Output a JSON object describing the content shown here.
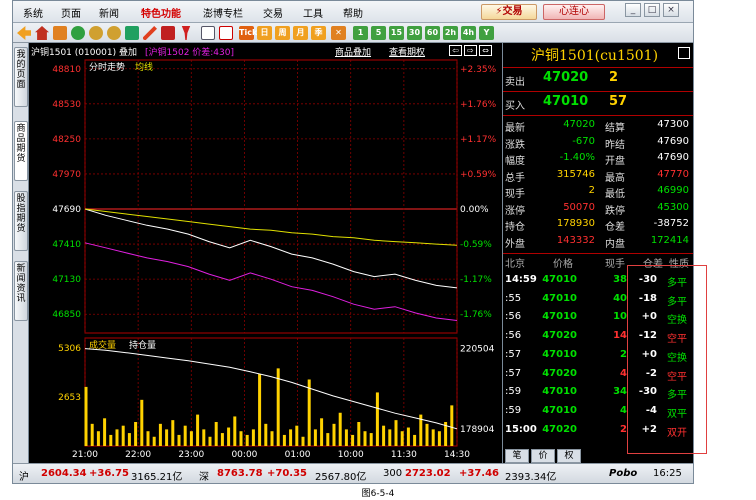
{
  "menu": {
    "items": [
      "系统",
      "页面",
      "新闻",
      "特色功能",
      "澎博专栏",
      "交易",
      "工具",
      "帮助"
    ],
    "active_index": 3,
    "trade_button": "⚡交易",
    "xinlian_button": "心连心",
    "window_buttons": [
      "_",
      "□",
      "×"
    ]
  },
  "toolbar": {
    "periods": [
      "1",
      "5",
      "15",
      "30",
      "60",
      "2h",
      "4h",
      "Y"
    ],
    "icons": [
      "back-icon",
      "home-icon",
      "book-icon",
      "refresh-icon",
      "zoom-in-icon",
      "zoom-out-icon",
      "flag-icon",
      "pen-icon",
      "delete-icon",
      "pin-icon",
      "table-icon",
      "trend-chart-icon",
      "tick-icon",
      "day-icon",
      "week-icon",
      "month-icon",
      "season-icon",
      "cross-icon"
    ],
    "tick_label": "Tick",
    "day_label": "日",
    "week_label": "周",
    "month_label": "月",
    "season_label": "季"
  },
  "side_tabs": [
    "我的页面",
    "商品期货",
    "股指期货",
    "新闻资讯"
  ],
  "chart_header": {
    "title": "沪铜1501 (010001) 叠加",
    "overlay": "[沪铜1502 价差:430]",
    "link_overlay": "商品叠加",
    "link_period": "查看期权"
  },
  "chart_data": [
    {
      "type": "line",
      "title": "分时走势",
      "legend": [
        "分时走势",
        "均线"
      ],
      "x_ticks": [
        "21:00",
        "22:00",
        "23:00",
        "00:00",
        "01:00",
        "10:00",
        "11:30",
        "14:30"
      ],
      "ylim": [
        46700,
        48880
      ],
      "y_ticks_left": [
        "48810",
        "48530",
        "48250",
        "47970",
        "47690",
        "47410",
        "47130",
        "46850"
      ],
      "y_ticks_right": [
        "+2.35%",
        "+1.76%",
        "+1.17%",
        "+0.59%",
        "0.00%",
        "-0.59%",
        "-1.17%",
        "-1.76%"
      ],
      "series": [
        {
          "name": "分时走势",
          "color": "#ffffff",
          "values": [
            47690,
            47640,
            47600,
            47560,
            47530,
            47490,
            47430,
            47380,
            47440,
            47390,
            47330,
            47300,
            47250,
            47190,
            47150,
            47170,
            47120,
            47080,
            47060
          ]
        },
        {
          "name": "均线",
          "color": "#e0e000",
          "values": [
            47690,
            47670,
            47650,
            47630,
            47610,
            47590,
            47570,
            47550,
            47530,
            47520,
            47500,
            47490,
            47470,
            47460,
            47440,
            47430,
            47420,
            47410,
            47400
          ]
        },
        {
          "color": "#e020e0",
          "values": [
            47420,
            47380,
            47340,
            47300,
            47270,
            47230,
            47170,
            47120,
            47180,
            47130,
            47070,
            47040,
            46990,
            46930,
            46890,
            46910,
            46860,
            46820,
            46800
          ]
        }
      ]
    },
    {
      "type": "bar",
      "legend": [
        "成交量",
        "持仓量"
      ],
      "y_ticks_left": [
        "5306",
        "2653"
      ],
      "y_ticks_right": [
        "220504",
        "178904"
      ],
      "open_interest": [
        220504,
        219600,
        218400,
        217000,
        215600,
        214200,
        212500,
        210800,
        208500,
        206000,
        203000,
        199500,
        196000,
        193000,
        190000,
        187000,
        184500,
        182000,
        178904
      ],
      "volume": [
        3200,
        1200,
        800,
        1500,
        600,
        900,
        1100,
        700,
        1300,
        2500,
        800,
        500,
        1200,
        900,
        1400,
        600,
        1100,
        800,
        1700,
        900,
        500,
        1300,
        700,
        1000,
        1600,
        800,
        600,
        900,
        3900,
        1200,
        800,
        4200,
        600,
        900,
        1100,
        500,
        3600,
        900,
        1500,
        700,
        1200,
        1800,
        900,
        600,
        1300,
        800,
        700,
        2900,
        1100,
        900,
        1400,
        800,
        1000,
        600,
        1700,
        1200,
        900,
        800,
        1300,
        2200
      ]
    }
  ],
  "quote": {
    "title": "沪铜1501(cu1501)",
    "sell_label": "卖出",
    "sell_price": "47020",
    "sell_qty": "2",
    "buy_label": "买入",
    "buy_price": "47010",
    "buy_qty": "57",
    "rows": [
      {
        "l1": "最新",
        "v1": "47020",
        "c1": "#00e000",
        "l2": "结算",
        "v2": "47300",
        "c2": "#ffffff"
      },
      {
        "l1": "涨跌",
        "v1": "-670",
        "c1": "#00e000",
        "l2": "昨结",
        "v2": "47690",
        "c2": "#ffffff"
      },
      {
        "l1": "幅度",
        "v1": "-1.40%",
        "c1": "#00e000",
        "l2": "开盘",
        "v2": "47690",
        "c2": "#ffffff"
      },
      {
        "l1": "总手",
        "v1": "315746",
        "c1": "#ffd200",
        "l2": "最高",
        "v2": "47770",
        "c2": "#ff3030"
      },
      {
        "l1": "现手",
        "v1": "2",
        "c1": "#ffd200",
        "l2": "最低",
        "v2": "46990",
        "c2": "#00e000"
      },
      {
        "l1": "涨停",
        "v1": "50070",
        "c1": "#ff3030",
        "l2": "跌停",
        "v2": "45300",
        "c2": "#00e000"
      },
      {
        "l1": "持仓",
        "v1": "178930",
        "c1": "#ffd200",
        "l2": "仓差",
        "v2": "-38752",
        "c2": "#ffffff"
      },
      {
        "l1": "外盘",
        "v1": "143332",
        "c1": "#ff3030",
        "l2": "内盘",
        "v2": "172414",
        "c2": "#00e000"
      }
    ],
    "tick_header": [
      "北京",
      "价格",
      "现手",
      "仓差",
      "性质"
    ],
    "ticks": [
      {
        "time": "14:59",
        "price": "47010",
        "pc": "#00e000",
        "qty": "38",
        "qc": "#00e000",
        "diff": "-30",
        "type": "多平",
        "tc": "#00e000"
      },
      {
        "time": ":55",
        "price": "47010",
        "pc": "#00e000",
        "qty": "40",
        "qc": "#00e000",
        "diff": "-18",
        "type": "多平",
        "tc": "#00e000"
      },
      {
        "time": ":56",
        "price": "47010",
        "pc": "#00e000",
        "qty": "10",
        "qc": "#00e000",
        "diff": "+0",
        "type": "空换",
        "tc": "#00e000"
      },
      {
        "time": ":56",
        "price": "47020",
        "pc": "#00e000",
        "qty": "14",
        "qc": "#ff3030",
        "diff": "-12",
        "type": "空平",
        "tc": "#ff3030"
      },
      {
        "time": ":57",
        "price": "47010",
        "pc": "#00e000",
        "qty": "2",
        "qc": "#00e000",
        "diff": "+0",
        "type": "空换",
        "tc": "#00e000"
      },
      {
        "time": ":57",
        "price": "47020",
        "pc": "#00e000",
        "qty": "4",
        "qc": "#ff3030",
        "diff": "-2",
        "type": "空平",
        "tc": "#ff3030"
      },
      {
        "time": ":59",
        "price": "47010",
        "pc": "#00e000",
        "qty": "34",
        "qc": "#00e000",
        "diff": "-30",
        "type": "多平",
        "tc": "#00e000"
      },
      {
        "time": ":59",
        "price": "47010",
        "pc": "#00e000",
        "qty": "4",
        "qc": "#00e000",
        "diff": "-4",
        "type": "双平",
        "tc": "#00e000"
      },
      {
        "time": "15:00",
        "price": "47020",
        "pc": "#00e000",
        "qty": "2",
        "qc": "#ff3030",
        "diff": "+2",
        "type": "双开",
        "tc": "#ff3030"
      }
    ],
    "bottom_tabs": [
      "笔",
      "价",
      "权"
    ]
  },
  "status": {
    "items": [
      {
        "text": "沪",
        "color": "#000000"
      },
      {
        "text": "2604.34",
        "color": "#d00000"
      },
      {
        "text": "+36.75",
        "color": "#d00000"
      },
      {
        "text": "3165.21亿",
        "color": "#000000"
      },
      {
        "text": "深",
        "color": "#000000"
      },
      {
        "text": "8763.78",
        "color": "#d00000"
      },
      {
        "text": "+70.35",
        "color": "#d00000"
      },
      {
        "text": "2567.80亿",
        "color": "#000000"
      },
      {
        "text": "300",
        "color": "#000000"
      },
      {
        "text": "2723.02",
        "color": "#d00000"
      },
      {
        "text": "+37.46",
        "color": "#d00000"
      },
      {
        "text": "2393.34亿",
        "color": "#000000"
      }
    ],
    "brand": "Pobo",
    "time": "16:25"
  },
  "caption": "图6-5-4"
}
